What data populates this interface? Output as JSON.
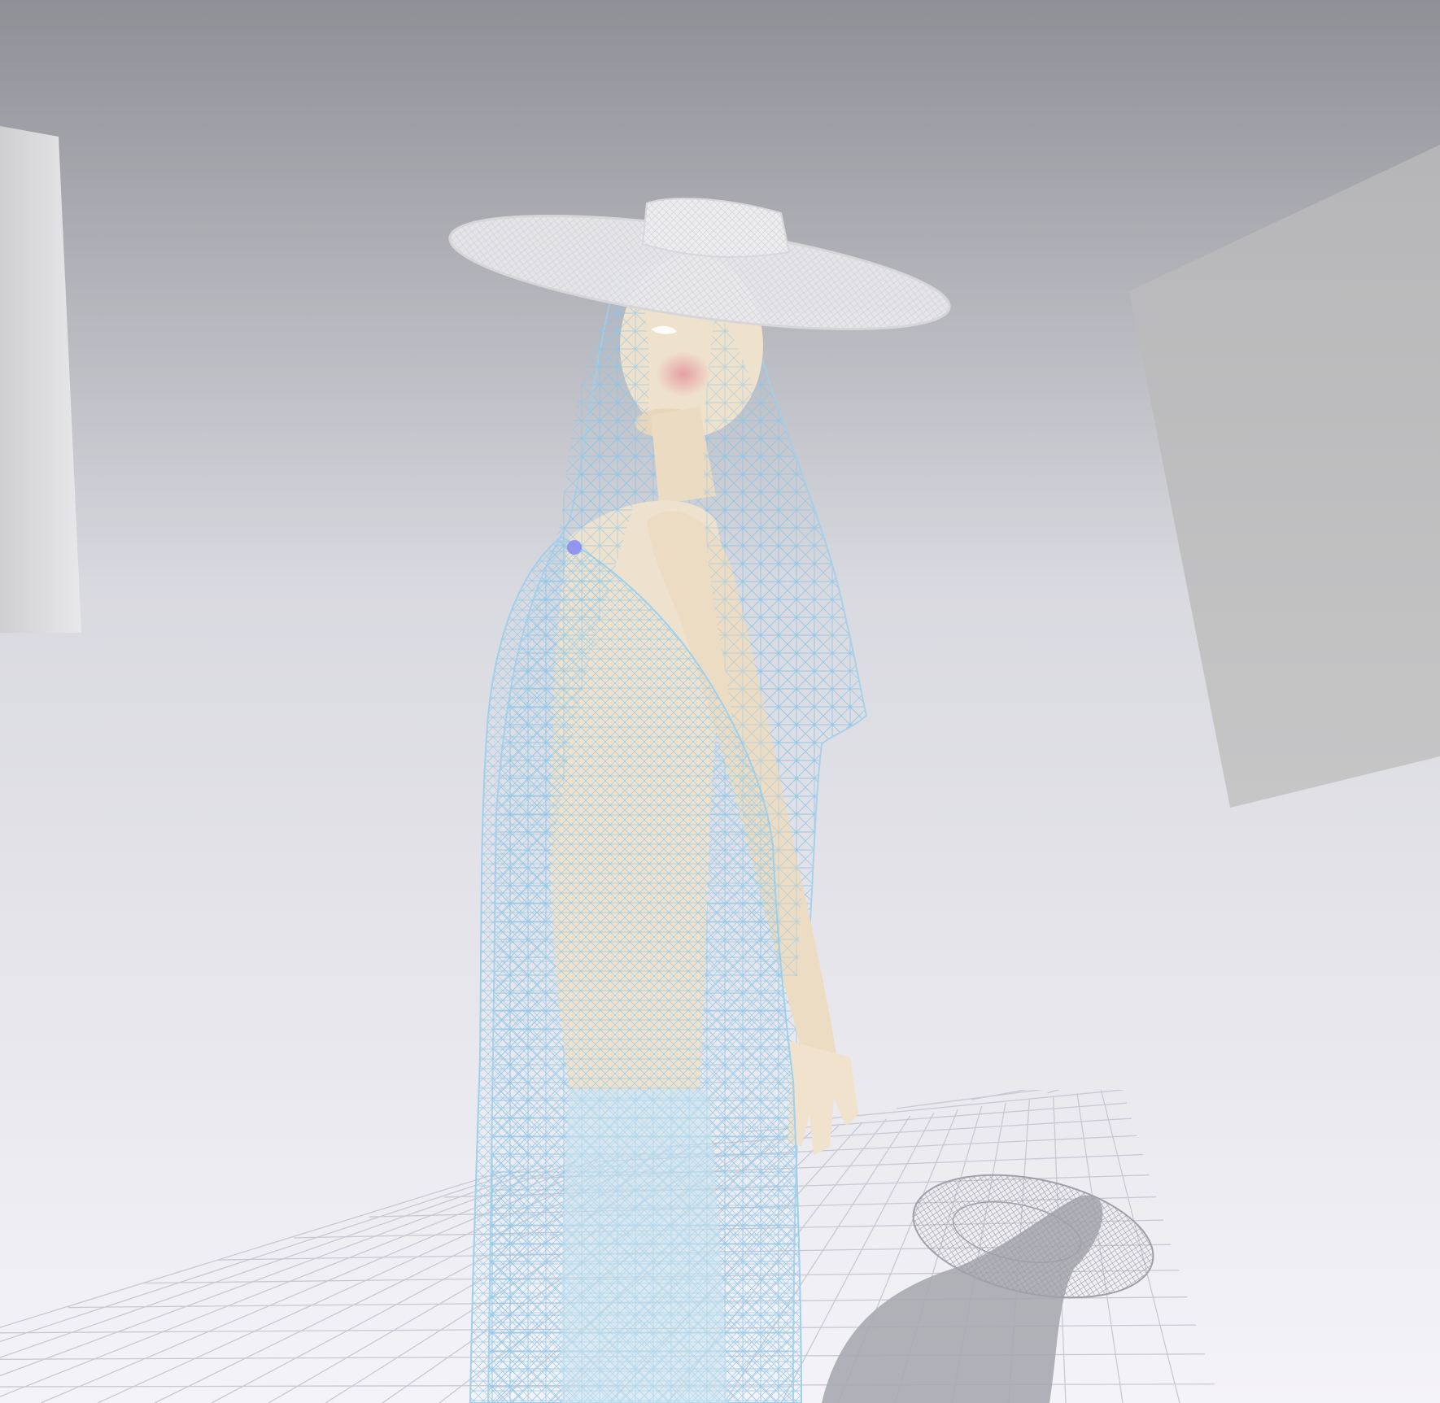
{
  "viewport": {
    "background_top": "#8f8f96",
    "background_mid": "#d9d9e0",
    "background_bottom": "#f4f3f8"
  },
  "colors": {
    "floor_grid": "#c9c9d3",
    "left_box": "#dcdcdc",
    "right_box": "#bdbdbd",
    "garment_mesh": "#9fd0ec",
    "garment_fill": "#b8dcee",
    "skin": "#efe0c8",
    "hat": "#e6e6e9",
    "shadow": "#a7a7ad",
    "blush": "#e6a0a6",
    "selection_marker": "#8a8ff0"
  },
  "scene": {
    "avatar": "female-avatar",
    "garments": [
      "wide-brim-hat",
      "sheer-veil",
      "mesh-dress"
    ],
    "display_mode": "wireframe-overlay",
    "floor_grid": "on"
  }
}
